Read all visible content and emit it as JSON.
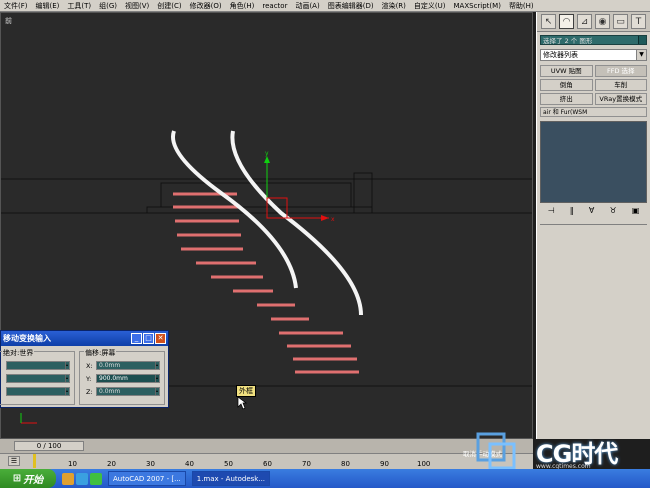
{
  "menu": [
    "文件(F)",
    "编辑(E)",
    "工具(T)",
    "组(G)",
    "视图(V)",
    "创建(C)",
    "修改器(O)",
    "角色(H)",
    "reactor",
    "动画(A)",
    "图表编辑器(D)",
    "渲染(R)",
    "自定义(U)",
    "MAXScript(M)",
    "帮助(H)"
  ],
  "viewport": {
    "label": "前"
  },
  "command_panel": {
    "tab_icons": [
      "cursor-icon",
      "modify-icon",
      "hierarchy-icon",
      "motion-icon",
      "display-icon",
      "utilities-icon"
    ],
    "object_name": "选择了 2 个 图形",
    "modifier_list": "修改器列表",
    "buttons": [
      "UVW 贴图",
      "FFD 选择",
      "倒角",
      "车削",
      "挤出",
      "VRay置换模式"
    ],
    "wide_button": "air 和 Fur(WSM",
    "stack_tools": [
      "pin-icon",
      "show-end-icon",
      "unique-icon",
      "remove-icon",
      "configure-icon"
    ]
  },
  "dialog": {
    "title": "移动变换输入",
    "abs_group": "绝对:世界",
    "offset_group": "偏移:屏幕",
    "x_label": "X:",
    "y_label": "Y:",
    "z_label": "Z:",
    "x_value": "0.0mm",
    "y_value": "900.0mm",
    "z_value": "0.0mm"
  },
  "tooltip": "外框",
  "timeline": {
    "slider": "0 / 100",
    "ticks": [
      "10",
      "20",
      "30",
      "40",
      "50",
      "60",
      "70",
      "80",
      "90",
      "100"
    ]
  },
  "status_text": "取消手动模式",
  "taskbar": {
    "start": "开始",
    "tasks": [
      "AutoCAD 2007 - [...",
      "1.max - Autodesk..."
    ]
  },
  "logo": {
    "text": "CG时代",
    "url": "www.cgtimes.com"
  }
}
